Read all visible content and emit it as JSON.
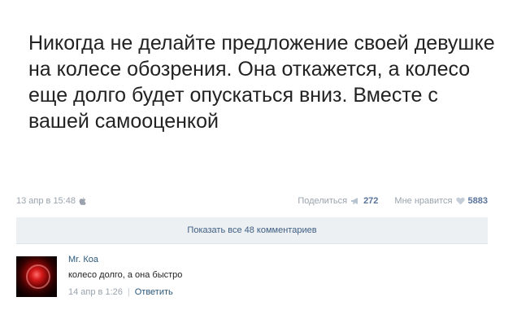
{
  "post": {
    "text": "Никогда не делайте предложение своей девушке на колесе обозрения. Она откажется, а колесо еще долго будет опускаться вниз. Вместе с вашей самооценкой",
    "date": "13 апр в 15:48",
    "share_label": "Поделиться",
    "share_count": "272",
    "like_label": "Мне нравится",
    "like_count": "5883"
  },
  "comments_bar": {
    "label": "Показать все 48 комментариев"
  },
  "comment": {
    "author": "Mr. Коа",
    "text": "колесо долго, а она быстро",
    "date": "14 апр в 1:26",
    "separator": "|",
    "reply_label": "Ответить"
  },
  "icons": {
    "device": "apple-icon",
    "share": "megaphone-icon",
    "like": "heart-icon"
  },
  "colors": {
    "link": "#2b587a",
    "muted": "#9aa3ad",
    "bar_bg": "#ecf0f3"
  }
}
